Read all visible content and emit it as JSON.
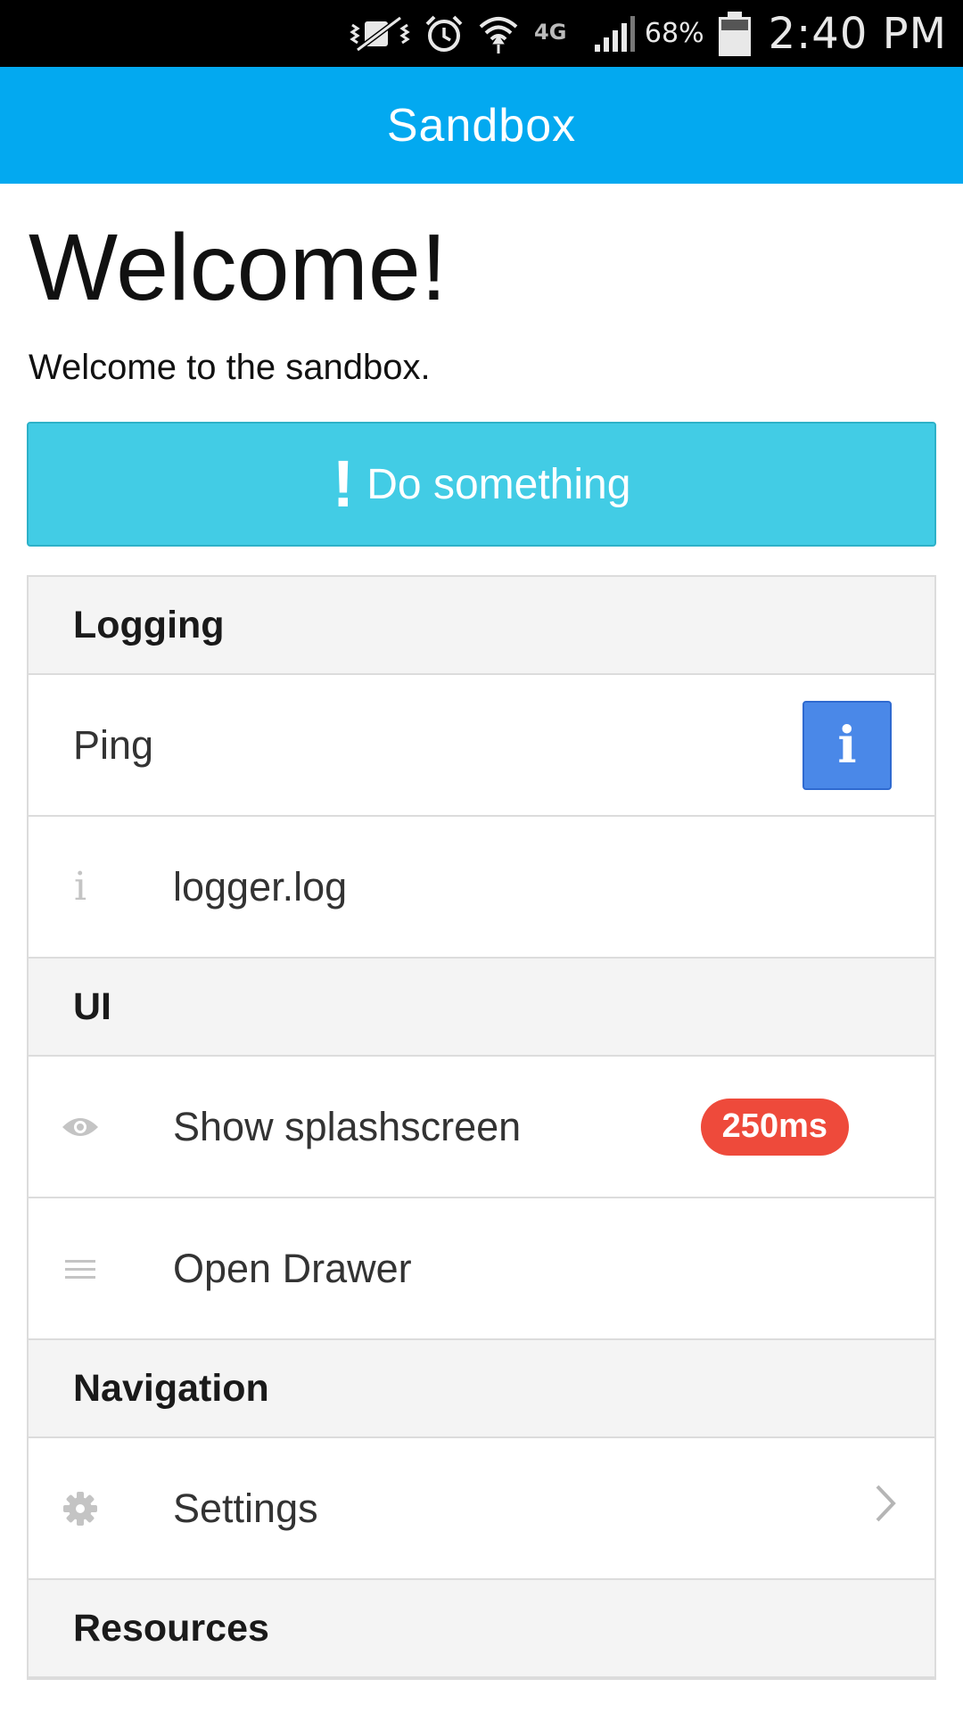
{
  "status_bar": {
    "battery_percent": "68%",
    "time": "2:40 PM",
    "network_label": "4G",
    "icons": [
      "vibrate-mute-icon",
      "alarm-icon",
      "wifi-icon",
      "4g-lte-icon",
      "signal-icon",
      "battery-icon"
    ]
  },
  "app_bar": {
    "title": "Sandbox"
  },
  "main": {
    "heading": "Welcome!",
    "intro": "Welcome to the sandbox.",
    "primary_button": {
      "icon_glyph": "!",
      "label": "Do something"
    }
  },
  "list": {
    "logging": {
      "header": "Logging",
      "ping": {
        "label": "Ping",
        "action_glyph": "i"
      },
      "logger": {
        "icon_glyph": "i",
        "label": "logger.log"
      }
    },
    "ui": {
      "header": "UI",
      "splash": {
        "label": "Show splashscreen",
        "badge": "250ms"
      },
      "drawer": {
        "label": "Open Drawer"
      }
    },
    "navigation": {
      "header": "Navigation",
      "settings": {
        "label": "Settings"
      }
    },
    "resources": {
      "header": "Resources"
    }
  },
  "colors": {
    "app_bar": "#03a9f0",
    "primary_button": "#42cce5",
    "info_button": "#4a88e8",
    "badge": "#ee4a3b"
  }
}
